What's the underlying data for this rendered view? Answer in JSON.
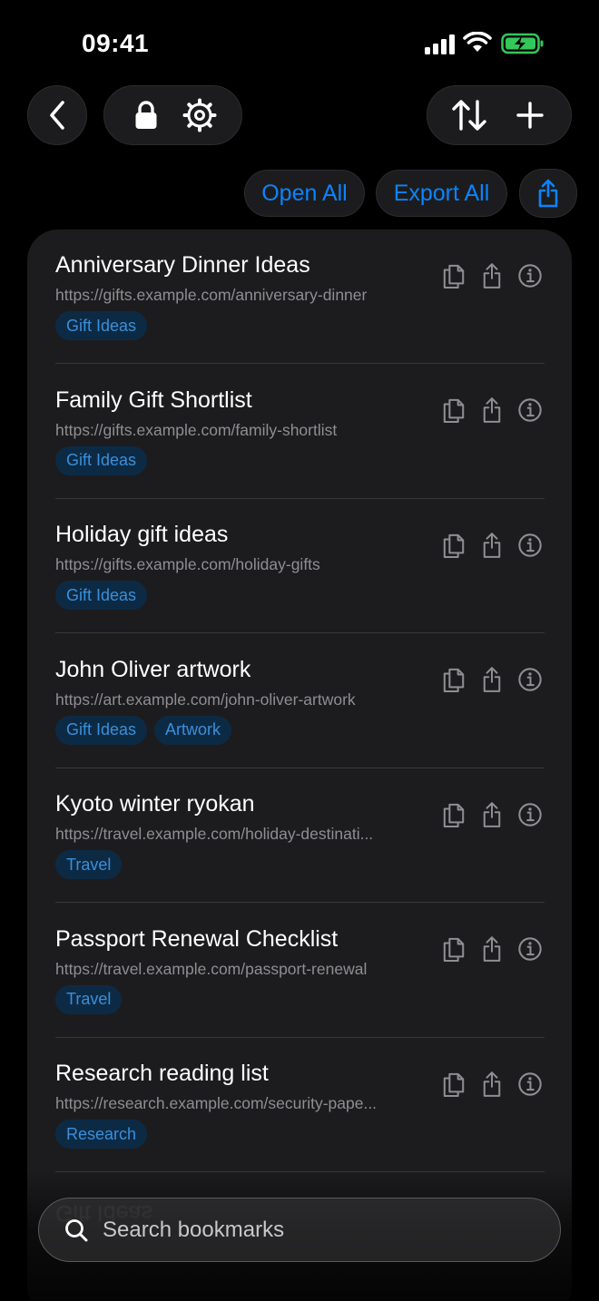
{
  "status_bar": {
    "time": "09:41"
  },
  "toolbar": {
    "back_icon": "chevron-left-icon",
    "lock_icon": "lock-icon",
    "settings_icon": "gear-icon",
    "sort_icon": "sort-arrows-icon",
    "add_icon": "plus-icon"
  },
  "actions": {
    "open_all": "Open All",
    "export_all": "Export All",
    "share_icon": "share-icon"
  },
  "bookmarks": [
    {
      "title": "Anniversary Dinner Ideas",
      "url": "https://gifts.example.com/anniversary-dinner",
      "tags": [
        "Gift Ideas"
      ]
    },
    {
      "title": "Family Gift Shortlist",
      "url": "https://gifts.example.com/family-shortlist",
      "tags": [
        "Gift Ideas"
      ]
    },
    {
      "title": "Holiday gift ideas",
      "url": "https://gifts.example.com/holiday-gifts",
      "tags": [
        "Gift Ideas"
      ]
    },
    {
      "title": "John Oliver artwork",
      "url": "https://art.example.com/john-oliver-artwork",
      "tags": [
        "Gift Ideas",
        "Artwork"
      ]
    },
    {
      "title": "Kyoto winter ryokan",
      "url": "https://travel.example.com/holiday-destinati...",
      "tags": [
        "Travel"
      ]
    },
    {
      "title": "Passport Renewal Checklist",
      "url": "https://travel.example.com/passport-renewal",
      "tags": [
        "Travel"
      ]
    },
    {
      "title": "Research reading list",
      "url": "https://research.example.com/security-pape...",
      "tags": [
        "Research"
      ]
    }
  ],
  "search": {
    "placeholder": "Search bookmarks"
  },
  "colors": {
    "accent": "#0a84ff",
    "background": "#000000",
    "card": "#1c1c1e",
    "tag_bg": "#0d2a45"
  }
}
